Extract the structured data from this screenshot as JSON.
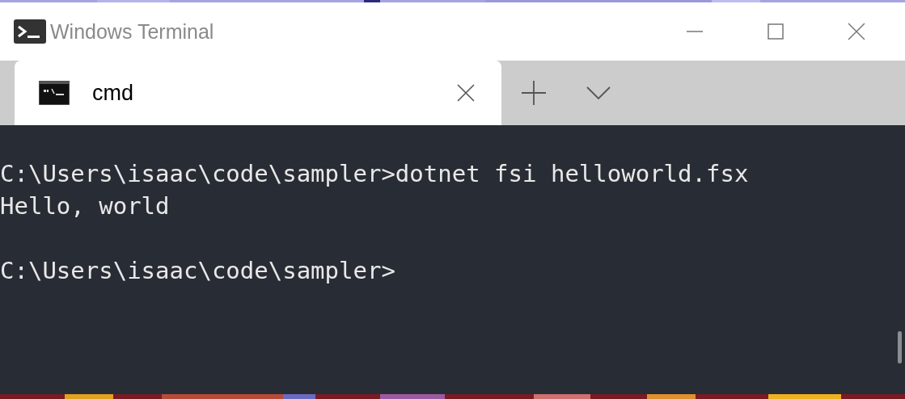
{
  "window": {
    "title": "Windows Terminal"
  },
  "tabs": [
    {
      "label": "cmd",
      "selected": true
    }
  ],
  "terminal": {
    "lines": [
      {
        "kind": "prompt",
        "text": "C:\\Users\\isaac\\code\\sampler>dotnet fsi helloworld.fsx"
      },
      {
        "kind": "output",
        "text": "Hello, world"
      },
      {
        "kind": "prompt",
        "text": "C:\\Users\\isaac\\code\\sampler>"
      }
    ]
  }
}
